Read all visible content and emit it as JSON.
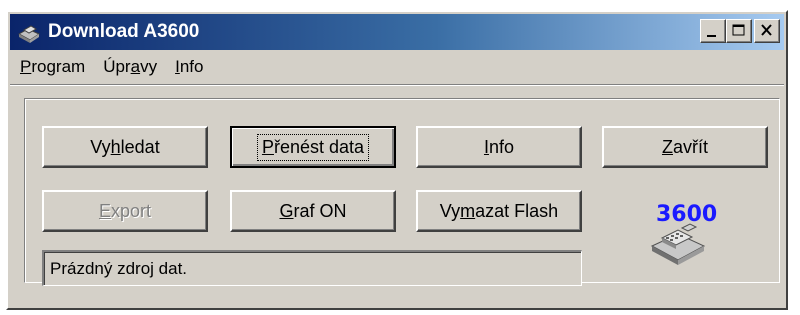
{
  "window": {
    "title": "Download A3600",
    "icon": "cash-register-icon"
  },
  "menu": [
    {
      "pre": "",
      "key": "P",
      "post": "rogram"
    },
    {
      "pre": "Úpr",
      "key": "a",
      "post": "vy"
    },
    {
      "pre": "",
      "key": "I",
      "post": "nfo"
    }
  ],
  "buttons": {
    "search": {
      "pre": "Vy",
      "key": "h",
      "post": "ledat"
    },
    "transfer": {
      "pre": "",
      "key": "P",
      "post": "řenést data"
    },
    "info": {
      "pre": "",
      "key": "I",
      "post": "nfo"
    },
    "close": {
      "pre": "",
      "key": "Z",
      "post": "avřít"
    },
    "export": {
      "pre": "",
      "key": "E",
      "post": "xport"
    },
    "graph": {
      "pre": "",
      "key": "G",
      "post": "raf ON"
    },
    "erase_flash": {
      "pre": "Vy",
      "key": "m",
      "post": "azat Flash"
    }
  },
  "status": "Prázdný zdroj dat.",
  "logo": {
    "number": "3600",
    "color": "#1a1aff",
    "icon": "cash-register-icon"
  }
}
